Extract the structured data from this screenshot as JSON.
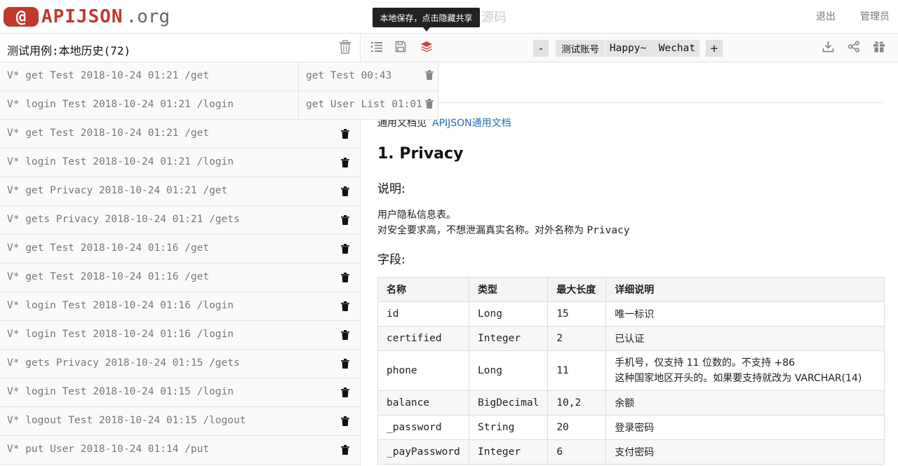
{
  "header": {
    "logo_symbol": "@",
    "logo_name": "APIJSON",
    "logo_suffix": ".org",
    "source_link": "源码",
    "logout": "退出",
    "admin": "管理员",
    "tooltip": "本地保存，点击隐藏共享",
    "brand_color": "#c0392b"
  },
  "left_panel": {
    "title": "测试用例:本地历史(72)",
    "items": [
      "V* get Test 2018-10-24 01:21 /get",
      "V* login Test 2018-10-24 01:21 /login",
      "V* get Test 2018-10-24 01:21 /get",
      "V* login Test 2018-10-24 01:21 /login",
      "V* get Privacy 2018-10-24 01:21 /get",
      "V* gets Privacy 2018-10-24 01:21 /gets",
      "V* get Test 2018-10-24 01:16 /get",
      "V* get Test 2018-10-24 01:16 /get",
      "V* login Test 2018-10-24 01:16 /login",
      "V* login Test 2018-10-24 01:16 /login",
      "V* gets Privacy 2018-10-24 01:15 /gets",
      "V* login Test 2018-10-24 01:15 /login",
      "V* logout Test 2018-10-24 01:15 /logout",
      "V* put User 2018-10-24 01:14 /put"
    ]
  },
  "popup": {
    "items": [
      "get Test 00:43",
      "get User List 01:01"
    ]
  },
  "toolbar": {
    "minus": "-",
    "account_label": "测试账号",
    "account_name": "Happy~  Wechat",
    "plus": "+"
  },
  "doc": {
    "note_prefix": "通用文档见",
    "note_link": "APIJSON通用文档",
    "title": "1. Privacy",
    "desc_heading": "说明:",
    "desc_line1": "用户隐私信息表。",
    "desc_line2_text": "对安全要求高，不想泄漏真实名称。对外名称为 ",
    "desc_line2_code": "Privacy",
    "fields_heading": "字段:",
    "table": {
      "headers": [
        "名称",
        "类型",
        "最大长度",
        "详细说明"
      ],
      "rows": [
        {
          "name": "id",
          "type": "Long",
          "len": "15",
          "desc1": "唯一标识",
          "desc2": ""
        },
        {
          "name": "certified",
          "type": "Integer",
          "len": "2",
          "desc1": "已认证",
          "desc2": ""
        },
        {
          "name": "phone",
          "type": "Long",
          "len": "11",
          "desc1": "手机号，仅支持 11 位数的。不支持 +86",
          "desc2": "这种国家地区开头的。如果要支持就改为 VARCHAR(14)"
        },
        {
          "name": "balance",
          "type": "BigDecimal",
          "len": "10,2",
          "desc1": "余额",
          "desc2": ""
        },
        {
          "name": "_password",
          "type": "String",
          "len": "20",
          "desc1": "登录密码",
          "desc2": ""
        },
        {
          "name": "_payPassword",
          "type": "Integer",
          "len": "6",
          "desc1": "支付密码",
          "desc2": ""
        }
      ]
    }
  }
}
